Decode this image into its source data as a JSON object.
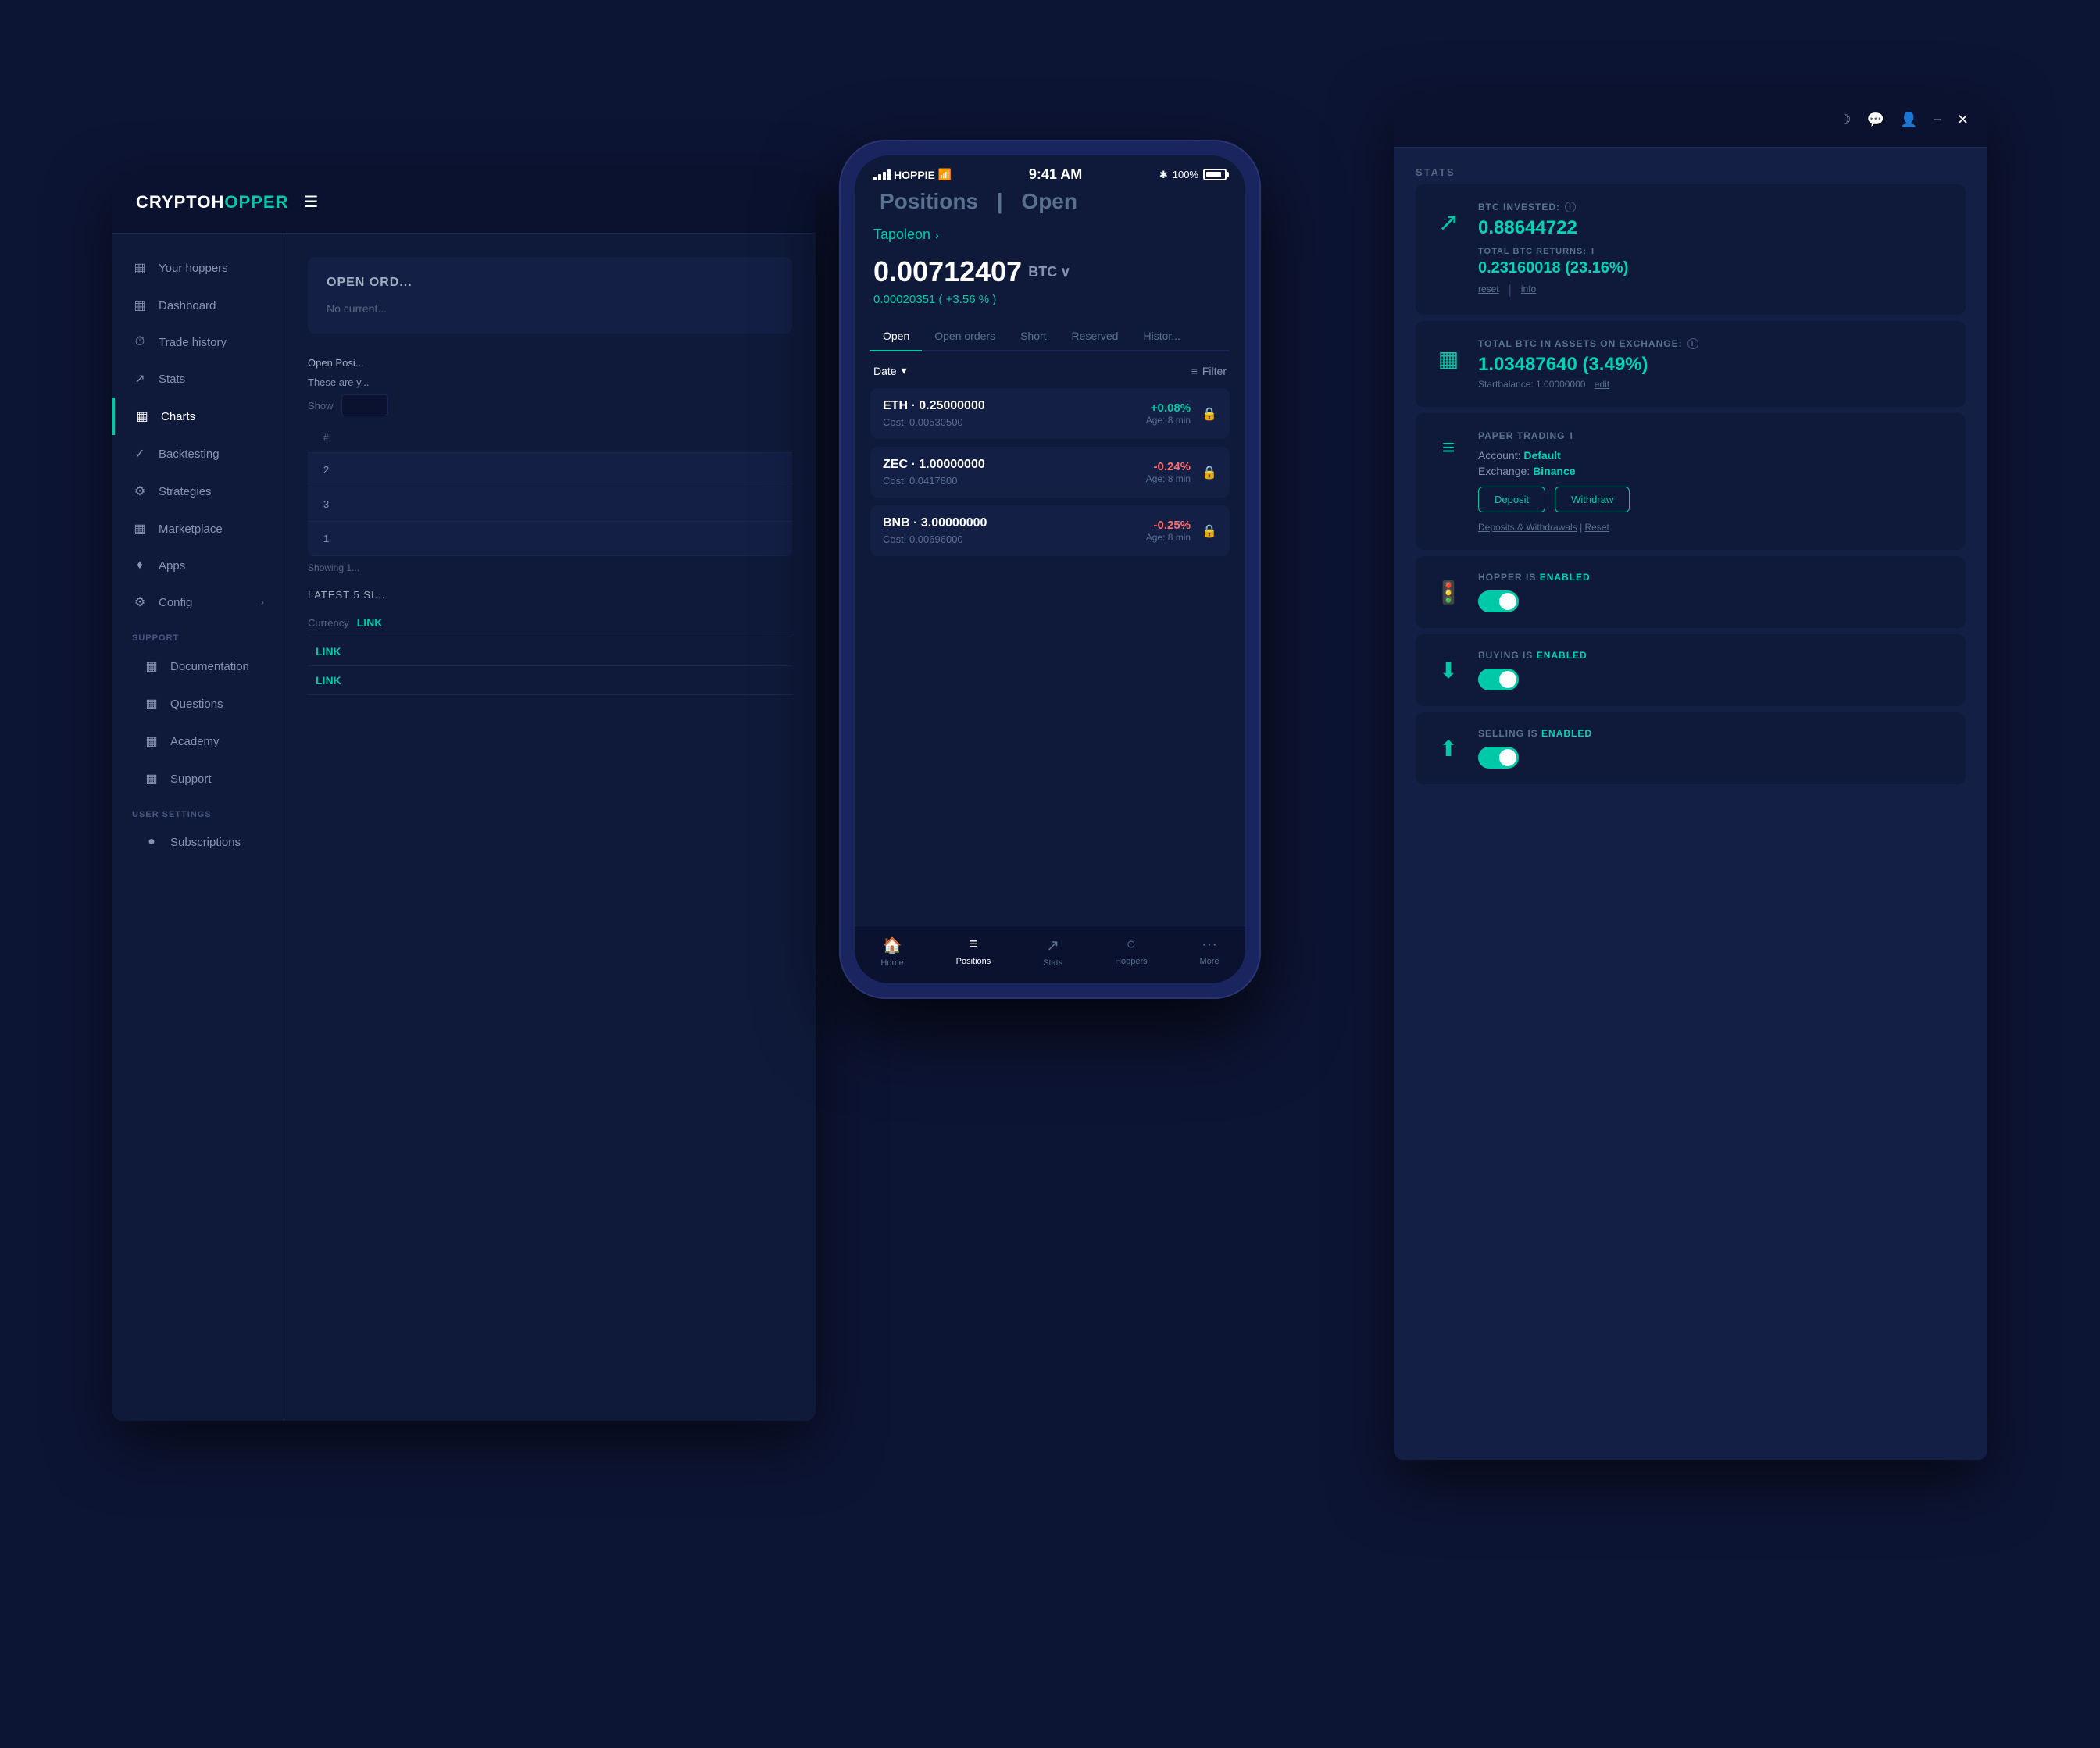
{
  "app": {
    "logo": "CRYPTOH",
    "logo_accent": "OPPER",
    "sidebar": {
      "items": [
        {
          "label": "Your hoppers",
          "icon": "☰",
          "active": false
        },
        {
          "label": "Dashboard",
          "icon": "▦",
          "active": false
        },
        {
          "label": "Trade history",
          "icon": "⏱",
          "active": false
        },
        {
          "label": "Stats",
          "icon": "↗",
          "active": false
        },
        {
          "label": "Charts",
          "icon": "▦",
          "active": true
        },
        {
          "label": "Backtesting",
          "icon": "✓",
          "active": false
        },
        {
          "label": "Strategies",
          "icon": "⚙",
          "active": false
        },
        {
          "label": "Marketplace",
          "icon": "▦",
          "active": false
        },
        {
          "label": "Apps",
          "icon": "♦",
          "active": false
        },
        {
          "label": "Config",
          "icon": "⚙",
          "active": false
        }
      ],
      "support_section": "SUPPORT",
      "support_items": [
        {
          "label": "Documentation"
        },
        {
          "label": "Questions"
        },
        {
          "label": "Academy"
        },
        {
          "label": "Support"
        }
      ],
      "user_section": "USER SETTINGS",
      "user_items": [
        {
          "label": "Subscriptions"
        }
      ]
    },
    "open_orders": {
      "title": "OPEN ORD...",
      "message": "No current...",
      "open_pos_label": "Open Posi...",
      "show_label": "Show",
      "table": {
        "columns": [
          "#",
          ""
        ],
        "rows": [
          {
            "num": "2"
          },
          {
            "num": "3"
          },
          {
            "num": "1"
          }
        ]
      },
      "these_are": "These are y...",
      "showing": "Showing 1..."
    },
    "latest_section": "LATEST 5 SI...",
    "currency_label": "Currency",
    "currency_links": [
      "LINK",
      "LINK",
      "LINK"
    ]
  },
  "stats": {
    "panel_title": "STATS",
    "btc_invested": {
      "label": "BTC INVESTED:",
      "value": "0.88644722",
      "total_returns_label": "TOTAL BTC RETURNS:",
      "total_returns_value": "0.23160018 (23.16%)",
      "reset": "reset",
      "info": "info"
    },
    "total_btc": {
      "label": "TOTAL BTC IN ASSETS ON EXCHANGE:",
      "value": "1.03487640 (3.49%)",
      "startbalance": "Startbalance: 1.00000000",
      "edit": "edit"
    },
    "paper_trading": {
      "label": "PAPER TRADING",
      "account": "Default",
      "exchange": "Binance",
      "deposit_btn": "Deposit",
      "withdraw_btn": "Withdraw",
      "deposits_link": "Deposits & Withdrawals",
      "reset_link": "Reset"
    },
    "hopper_enabled": {
      "label": "HOPPER IS",
      "status": "ENABLED",
      "enabled": true
    },
    "buying_enabled": {
      "label": "BUYING IS",
      "status": "ENABLED",
      "enabled": true
    },
    "selling_enabled": {
      "label": "SELLING IS",
      "status": "ENABLED",
      "enabled": true
    }
  },
  "mobile": {
    "carrier": "HOPPIE",
    "time": "9:41 AM",
    "battery": "100%",
    "page_title": "Positions",
    "page_sub": "Open",
    "hopper_name": "Tapoleon",
    "btc_amount": "0.00712407",
    "btc_currency": "BTC",
    "btc_sub_amount": "0.00020351",
    "btc_sub_pct": "+3.56 %",
    "tabs": [
      "Open",
      "Open orders",
      "Short",
      "Reserved",
      "Histor..."
    ],
    "active_tab": "Open",
    "filter_date": "Date",
    "filter_btn": "Filter",
    "positions": [
      {
        "coin": "ETH",
        "amount": "0.25000000",
        "cost": "0.00530500",
        "pct": "+0.08%",
        "age": "8 min",
        "positive": true
      },
      {
        "coin": "ZEC",
        "amount": "1.00000000",
        "cost": "0.0417800",
        "pct": "-0.24%",
        "age": "8 min",
        "positive": false
      },
      {
        "coin": "BNB",
        "amount": "3.00000000",
        "cost": "0.00696000",
        "pct": "-0.25%",
        "age": "8 min",
        "positive": false
      }
    ],
    "nav": [
      {
        "label": "Home",
        "icon": "🏠"
      },
      {
        "label": "Positions",
        "icon": "≡",
        "active": true
      },
      {
        "label": "Stats",
        "icon": "↗"
      },
      {
        "label": "Hoppers",
        "icon": "○"
      },
      {
        "label": "More",
        "icon": "···"
      }
    ]
  }
}
